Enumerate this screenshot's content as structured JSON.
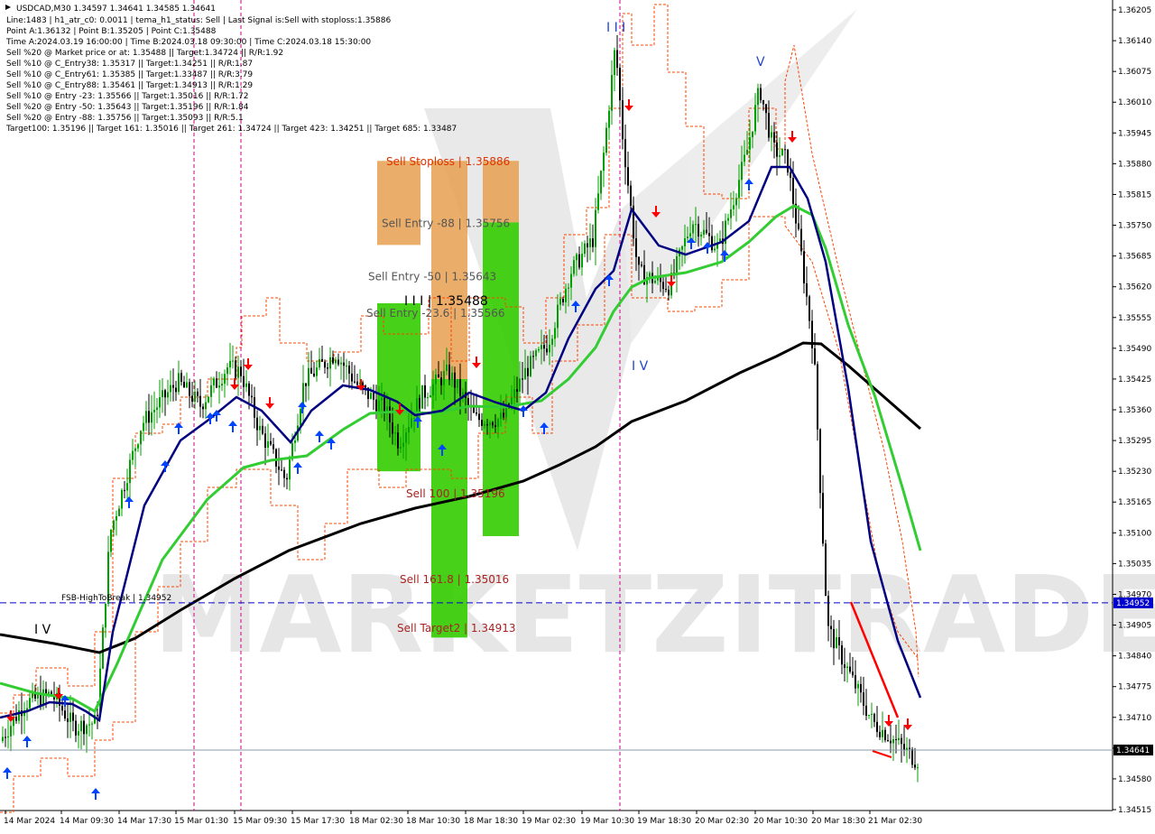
{
  "chart_data": {
    "type": "candlestick",
    "symbol_timeframe": "USDCAD,M30",
    "ohlc_header": "1.34597 1.34641 1.34585 1.34641",
    "info_lines": [
      "Line:1483 | h1_atr_c0: 0.0011 | tema_h1_status: Sell | Last Signal is:Sell with stoploss:1.35886",
      "Point A:1.36132 | Point B:1.35205 | Point C:1.35488",
      "Time A:2024.03.19 16:00:00 | Time B:2024.03.18 09:30:00 | Time C:2024.03.18 15:30:00",
      "Sell %20 @ Market price or at: 1.35488 || Target:1.34724 || R/R:1.92",
      "Sell %10 @ C_Entry38: 1.35317 || Target:1.34251 || R/R:1.87",
      "Sell %10 @ C_Entry61: 1.35385 || Target:1.33487 || R/R:3.79",
      "Sell %10 @ C_Entry88: 1.35461 || Target:1.34913 || R/R:1.29",
      "Sell %10 @ Entry -23: 1.35566 || Target:1.35016 || R/R:1.72",
      "Sell %20 @ Entry -50: 1.35643 || Target:1.35196 || R/R:1.84",
      "Sell %20 @ Entry -88: 1.35756 || Target:1.35093 || R/R:5.1",
      "Target100: 1.35196 || Target 161: 1.35016 || Target 261: 1.34724 || Target 423: 1.34251 || Target 685: 1.33487"
    ],
    "y_ticks": [
      "1.36205",
      "1.36140",
      "1.36075",
      "1.36010",
      "1.35945",
      "1.35880",
      "1.35815",
      "1.35750",
      "1.35685",
      "1.35620",
      "1.35555",
      "1.35490",
      "1.35425",
      "1.35360",
      "1.35295",
      "1.35230",
      "1.35165",
      "1.35100",
      "1.35035",
      "1.34970",
      "1.34905",
      "1.34840",
      "1.34775",
      "1.34710",
      "1.34645",
      "1.34580",
      "1.34515"
    ],
    "x_ticks": [
      "14 Mar 2024",
      "14 Mar 09:30",
      "14 Mar 17:30",
      "15 Mar 01:30",
      "15 Mar 09:30",
      "15 Mar 17:30",
      "18 Mar 02:30",
      "18 Mar 10:30",
      "18 Mar 18:30",
      "19 Mar 02:30",
      "19 Mar 10:30",
      "19 Mar 18:30",
      "20 Mar 02:30",
      "20 Mar 10:30",
      "20 Mar 18:30",
      "21 Mar 02:30"
    ],
    "ylim": [
      1.34515,
      1.36205
    ],
    "current_price": "1.34641",
    "fsb_level": {
      "label": "FSB-HighToBreak | 1.34952",
      "value": 1.34952,
      "tag": "1.34952"
    },
    "zones": [
      {
        "label": "Sell Stoploss | 1.35886",
        "value": 1.35886
      },
      {
        "label": "Sell Entry -88 | 1.35756",
        "value": 1.35756
      },
      {
        "label": "Sell Entry -50 | 1.35643",
        "value": 1.35643
      },
      {
        "label": "I I I | 1.35488",
        "value": 1.35488
      },
      {
        "label": "Sell Entry -23.6 | 1.35566",
        "value": 1.35566
      },
      {
        "label": "Sell 100 | 1.35196",
        "value": 1.35196
      },
      {
        "label": "Sell 161.8 | 1.35016",
        "value": 1.35016
      },
      {
        "label": "Sell Target2 | 1.34913",
        "value": 1.34913
      }
    ],
    "wave_labels": [
      "I V",
      "I I I",
      "V",
      "I V"
    ],
    "watermark": "MARKETZITRADE",
    "colors": {
      "bull": "#00a000",
      "bear": "#000000",
      "ema_fast": "#000080",
      "ema_mid": "#33cc33",
      "ema_slow": "#000000",
      "envelope": "#ff4400",
      "signal_sell": "#ff0000",
      "signal_buy": "#0044ff",
      "zone_orange": "#e8a050",
      "zone_green": "#33cc00",
      "fsb": "#0000cc"
    }
  }
}
